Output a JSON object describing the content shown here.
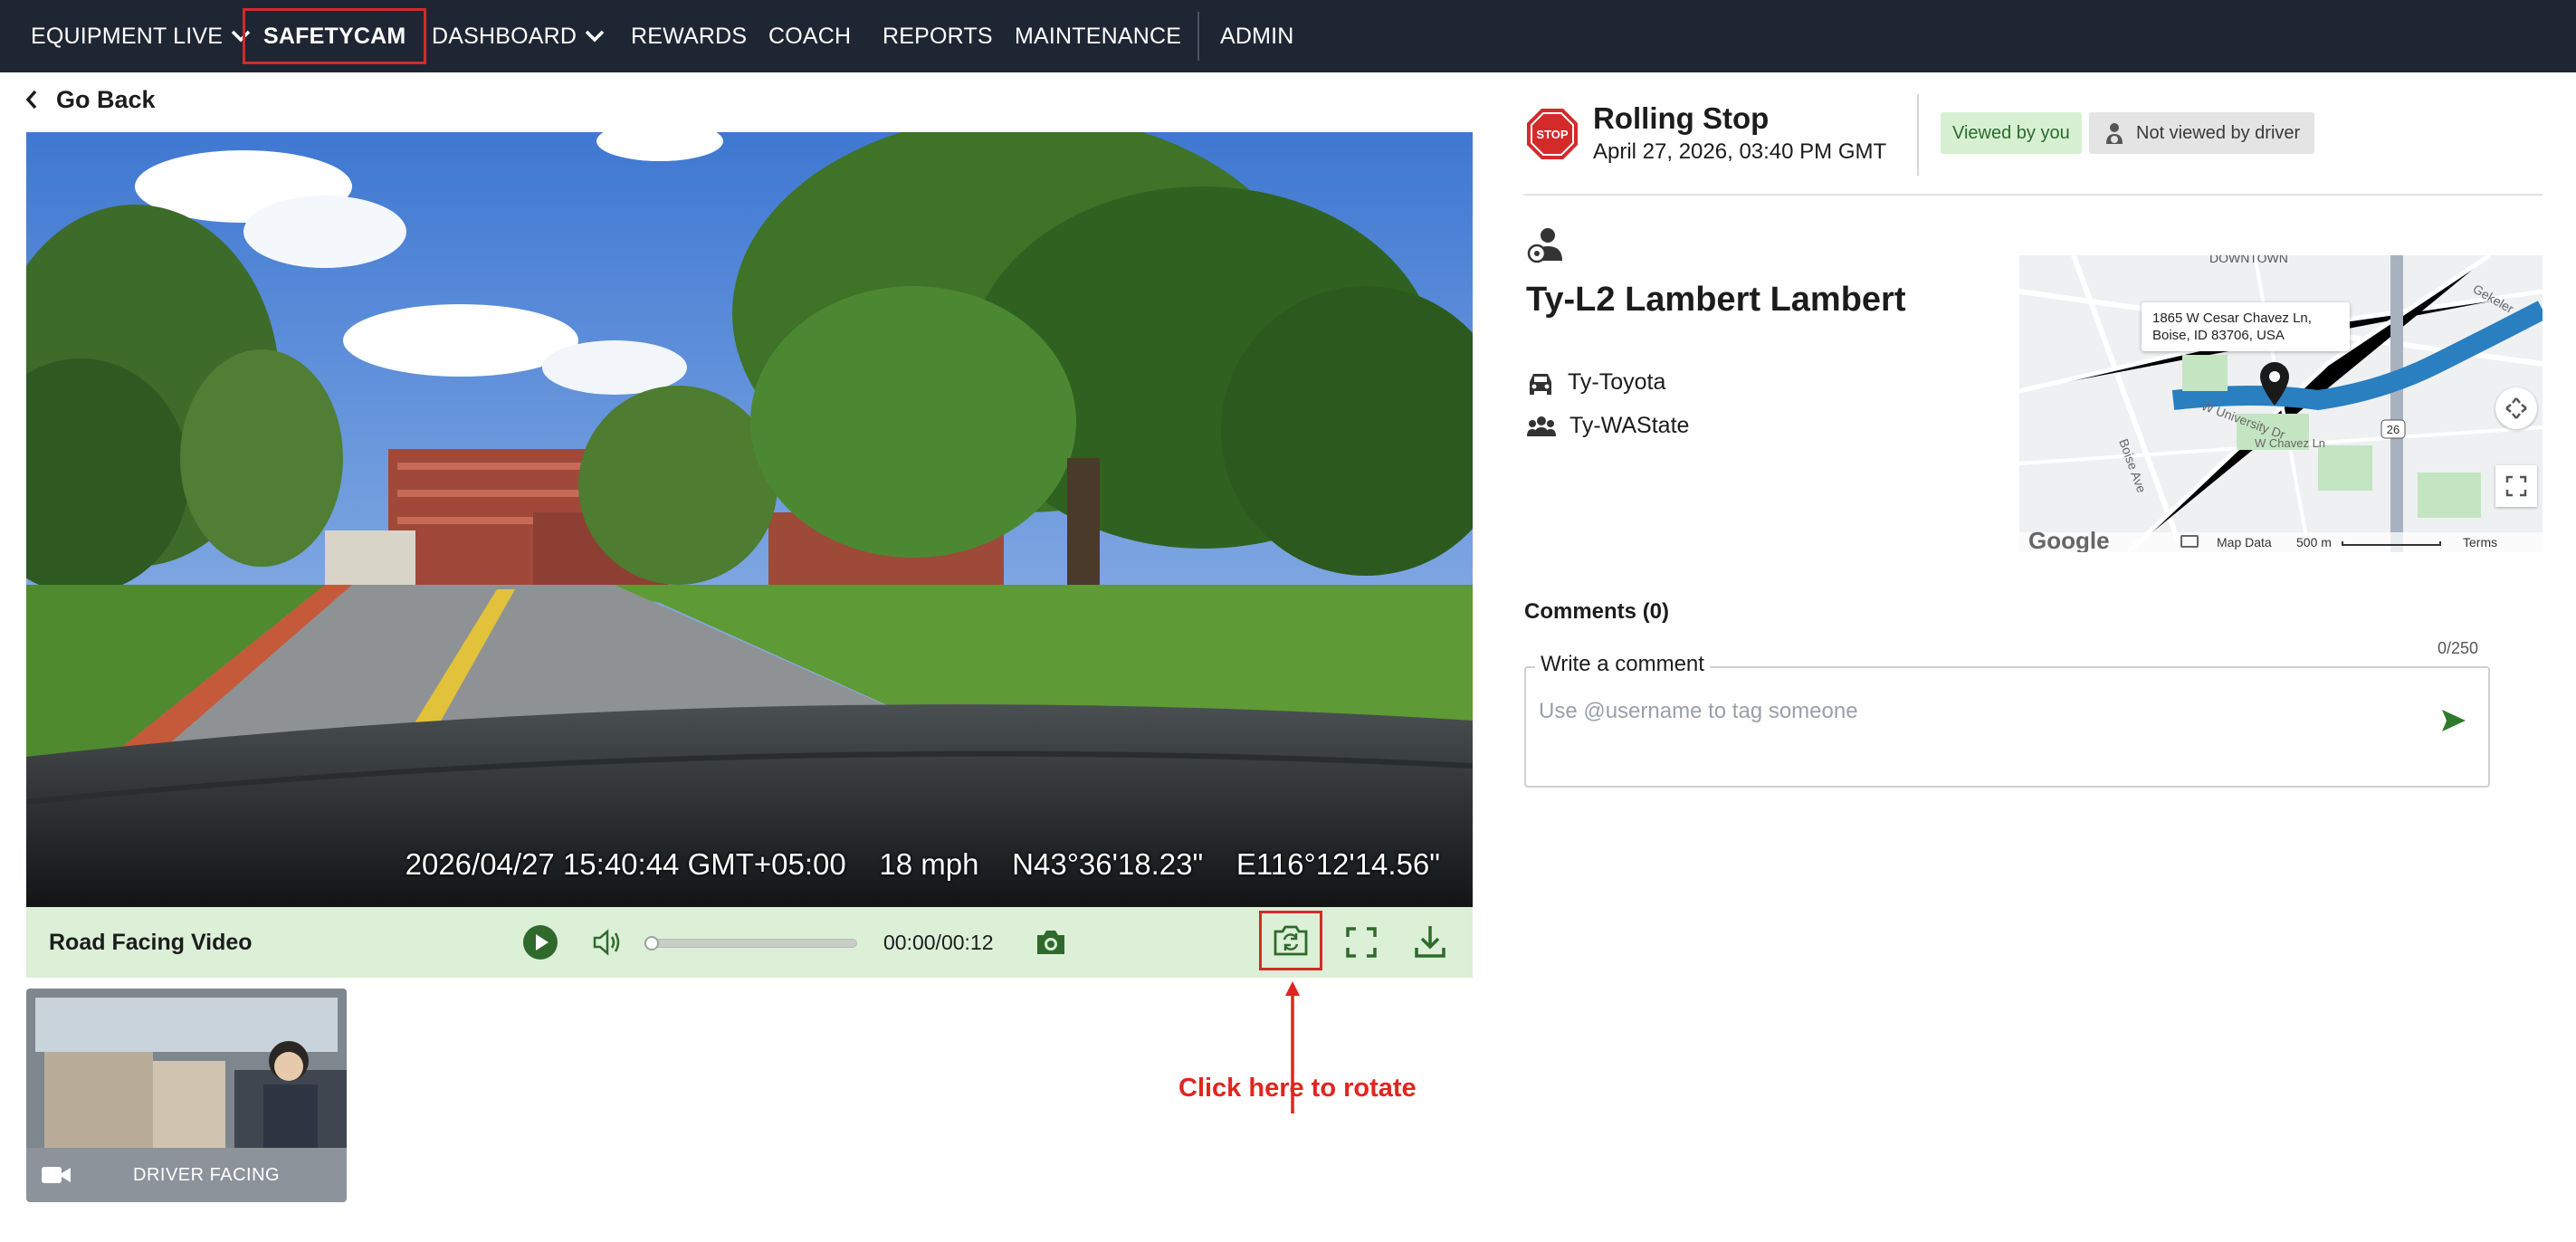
{
  "nav": {
    "equipment_live": "EQUIPMENT LIVE",
    "safetycam": "SAFETYCAM",
    "dashboard": "DASHBOARD",
    "rewards": "REWARDS",
    "coach": "COACH",
    "reports": "REPORTS",
    "maintenance": "MAINTENANCE",
    "admin": "ADMIN"
  },
  "go_back": "Go Back",
  "video": {
    "overlay": "2026/04/27 15:40:44 GMT+05:00    18 mph    N43°36'18.23\"    E116°12'14.56\"",
    "title": "Road Facing Video",
    "time": "00:00/00:12",
    "progress": 0
  },
  "annotation": "Click here to rotate",
  "thumbnail": {
    "label": "DRIVER FACING"
  },
  "event": {
    "title": "Rolling Stop",
    "datetime": "April 27, 2026, 03:40 PM GMT",
    "badge_viewed": "Viewed by you",
    "badge_not_viewed": "Not viewed by driver",
    "stop_icon_text": "STOP"
  },
  "driver": {
    "name": "Ty-L2 Lambert Lambert",
    "vehicle": "Ty-Toyota",
    "group": "Ty-WAState"
  },
  "map": {
    "address": "1865 W Cesar Chavez Ln, Boise, ID 83706, USA",
    "brand": "Google",
    "map_data": "Map Data",
    "scale": "500 m",
    "terms": "Terms",
    "route": "26",
    "street_1": "W Chavez Ln",
    "street_2": "W University Dr",
    "street_3": "Boise Ave",
    "street_4": "Gekeler",
    "street_5": "DOWNTOWN"
  },
  "comments": {
    "title": "Comments (0)",
    "count": "0/250",
    "label": "Write a comment",
    "placeholder": "Use @username to tag someone"
  },
  "colors": {
    "topbar": "#1f2633",
    "accent_green": "#2f7a2a",
    "control_bg": "#dcefd7",
    "highlight_red": "#d42a2a"
  }
}
